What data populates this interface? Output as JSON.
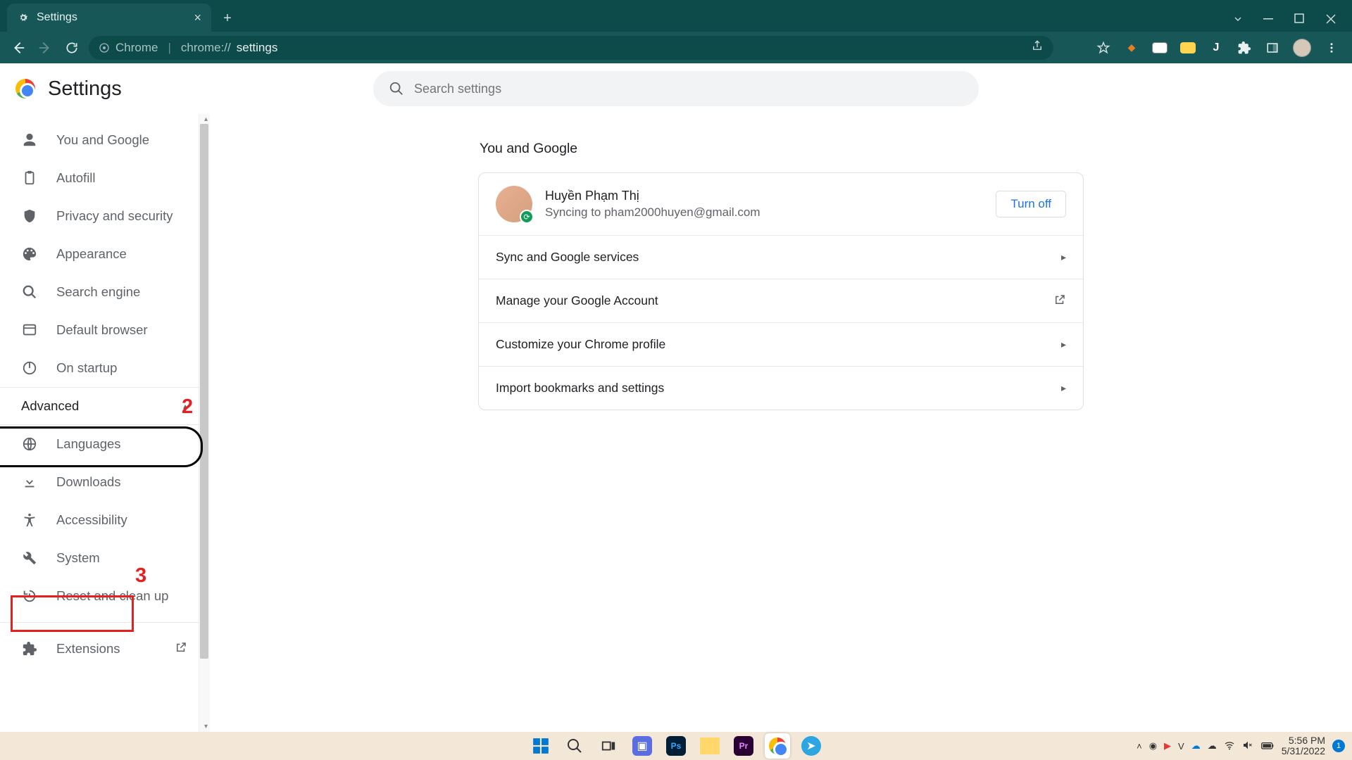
{
  "browser": {
    "tab_title": "Settings",
    "url_scheme": "Chrome",
    "url_host": "chrome://",
    "url_path": "settings"
  },
  "header": {
    "title": "Settings",
    "search_placeholder": "Search settings"
  },
  "sidebar": {
    "items": [
      {
        "label": "You and Google",
        "icon": "person"
      },
      {
        "label": "Autofill",
        "icon": "clipboard"
      },
      {
        "label": "Privacy and security",
        "icon": "shield"
      },
      {
        "label": "Appearance",
        "icon": "palette"
      },
      {
        "label": "Search engine",
        "icon": "search"
      },
      {
        "label": "Default browser",
        "icon": "browser"
      },
      {
        "label": "On startup",
        "icon": "power"
      }
    ],
    "advanced_label": "Advanced",
    "advanced_items": [
      {
        "label": "Languages",
        "icon": "globe"
      },
      {
        "label": "Downloads",
        "icon": "download"
      },
      {
        "label": "Accessibility",
        "icon": "accessibility"
      },
      {
        "label": "System",
        "icon": "wrench"
      },
      {
        "label": "Reset and clean up",
        "icon": "restore"
      }
    ],
    "extensions_label": "Extensions"
  },
  "main": {
    "section_title": "You and Google",
    "sync": {
      "name": "Huyền Phạm Thị",
      "status": "Syncing to pham2000huyen@gmail.com",
      "turnoff": "Turn off"
    },
    "rows": [
      {
        "label": "Sync and Google services",
        "arrow": "chevron"
      },
      {
        "label": "Manage your Google Account",
        "arrow": "external"
      },
      {
        "label": "Customize your Chrome profile",
        "arrow": "chevron"
      },
      {
        "label": "Import bookmarks and settings",
        "arrow": "chevron"
      }
    ]
  },
  "annotations": {
    "num2": "2",
    "num3": "3"
  },
  "taskbar": {
    "time": "5:56 PM",
    "date": "5/31/2022",
    "notif": "1"
  }
}
